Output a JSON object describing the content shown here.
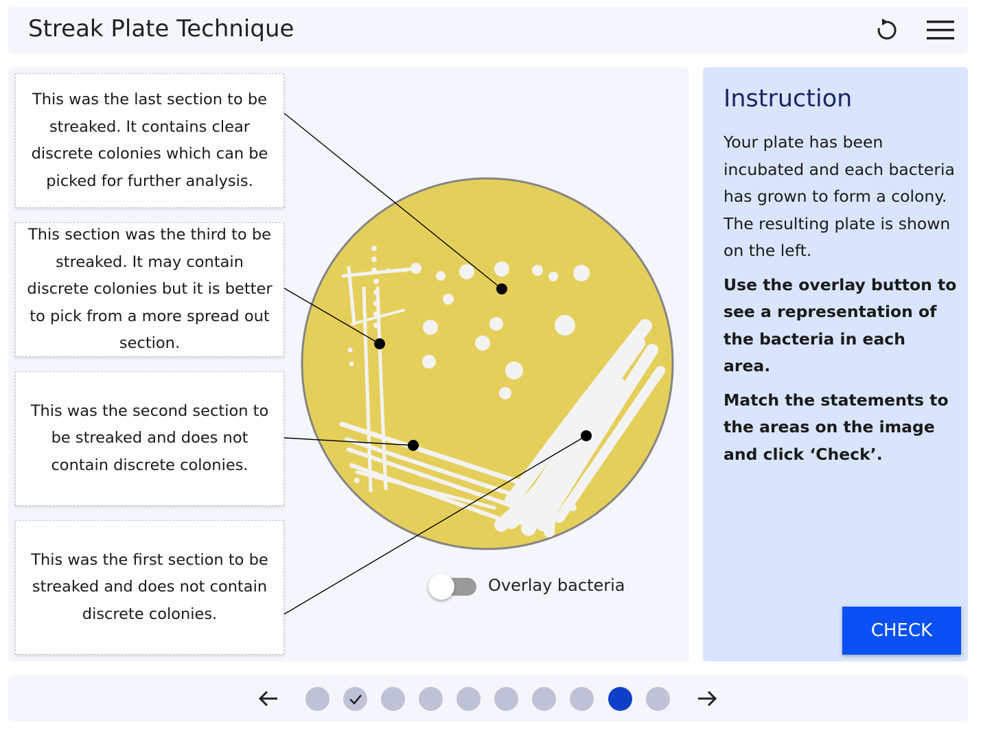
{
  "header": {
    "title": "Streak Plate Technique",
    "reset_icon": "reset-icon",
    "menu_icon": "hamburger-menu-icon"
  },
  "statements": [
    "This was the last section to be streaked. It contains clear discrete colonies which can be picked for further analysis.",
    "This section was the third to be streaked. It may contain discrete colonies but it is better to pick from a more spread out section.",
    "This was the second section to be streaked and does not contain discrete colonies.",
    "This was the first section to be streaked and does not contain discrete colonies."
  ],
  "overlay": {
    "label": "Overlay bacteria",
    "enabled": false
  },
  "instruction": {
    "title": "Instruction",
    "paragraph_1": "Your plate has been incubated and each bacteria has grown to form a colony. The resulting plate is shown on the left.",
    "paragraph_2": "Use the overlay button to see a representation of the bacteria in each area.",
    "paragraph_3": "Match the statements to the areas on the image and click ‘Check’.",
    "check_label": "CHECK"
  },
  "pagination": {
    "total": 10,
    "current": 9,
    "completed": [
      2
    ],
    "prev_icon": "arrow-left-icon",
    "next_icon": "arrow-right-icon"
  },
  "colors": {
    "agar": "#e5cf5b",
    "plate_border": "#858585",
    "accent": "#0a50f5",
    "active_dot": "#0f40c8",
    "inactive_dot": "#bfc2d6"
  }
}
